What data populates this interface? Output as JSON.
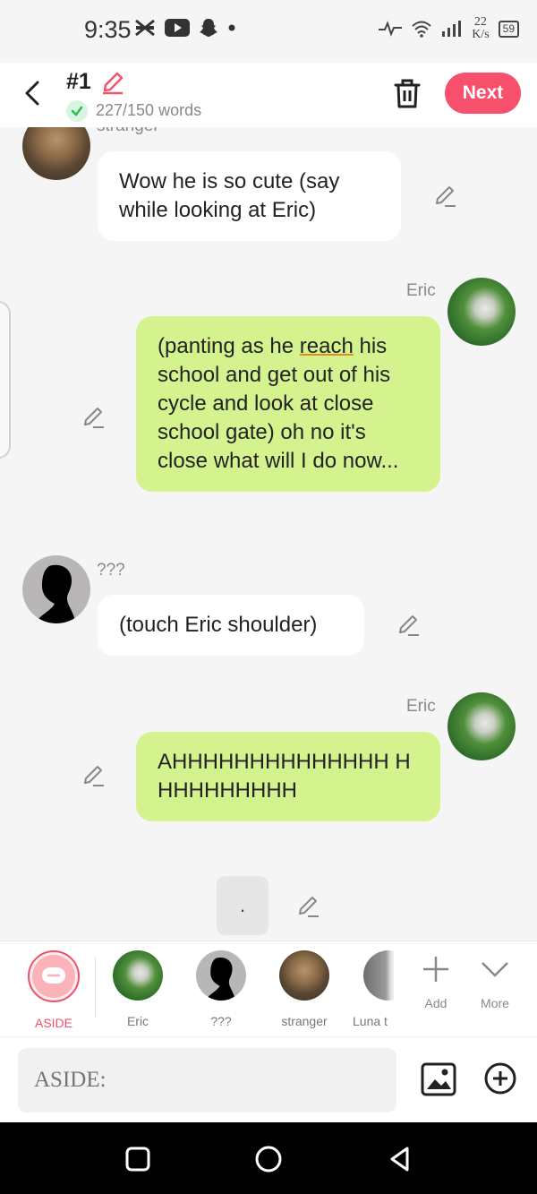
{
  "status": {
    "time": "9:35",
    "net_speed_value": "22",
    "net_speed_unit": "K/s",
    "battery": "59"
  },
  "header": {
    "title": "#1",
    "word_count": "227/150 words",
    "next_label": "Next"
  },
  "messages": [
    {
      "sender": "stranger",
      "side": "left",
      "text": "Wow he is so cute (say while looking at Eric)"
    },
    {
      "sender": "Eric",
      "side": "right",
      "text_pre": "(panting as he ",
      "text_underlined": "reach",
      "text_post": " his school and get out of his cycle and look at close school gate) oh no it's close what will I do now..."
    },
    {
      "sender": "???",
      "side": "left",
      "text": "(touch Eric shoulder)"
    },
    {
      "sender": "Eric",
      "side": "right",
      "text": "AHHHHHHHHHHHHHH HHHHHHHHHH"
    }
  ],
  "draft_dot": ".",
  "characters": [
    {
      "label": "ASIDE",
      "selected": true
    },
    {
      "label": "Eric"
    },
    {
      "label": "???"
    },
    {
      "label": "stranger"
    },
    {
      "label": "Luna t"
    }
  ],
  "tools": {
    "add_label": "Add",
    "more_label": "More"
  },
  "input": {
    "placeholder": "ASIDE:"
  },
  "colors": {
    "accent": "#f7506c",
    "bubble_user": "#d4f28d",
    "bubble_other": "#ffffff"
  }
}
